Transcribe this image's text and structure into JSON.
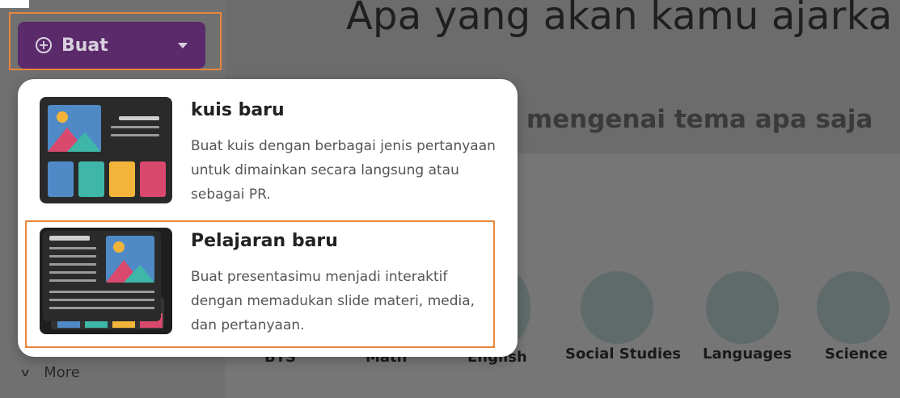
{
  "page": {
    "headline": "Apa yang akan kamu ajarka",
    "subheadline": "z mengenai tema apa saja"
  },
  "create_button": {
    "label": "Buat",
    "plus_icon": "⊕",
    "icon": "plus-circle-icon",
    "caret_icon": "caret-down-icon"
  },
  "create_menu": {
    "items": [
      {
        "title": "kuis baru",
        "description": "Buat kuis dengan berbagai jenis pertanyaan untuk dimainkan secara langsung atau sebagai PR.",
        "icon": "quiz-thumbnail-icon"
      },
      {
        "title": "Pelajaran baru",
        "description": "Buat presentasimu menjadi interaktif dengan memadukan slide materi, media, dan pertanyaan.",
        "icon": "lesson-thumbnail-icon"
      }
    ]
  },
  "categories": [
    {
      "label": "BTS"
    },
    {
      "label": "Math"
    },
    {
      "label": "English"
    },
    {
      "label": "Social Studies"
    },
    {
      "label": "Languages"
    },
    {
      "label": "Science"
    }
  ],
  "sidebar": {
    "more_label": "More",
    "more_icon": "chevron-down-icon"
  },
  "colors": {
    "accent": "#5a2a6a",
    "highlight": "#e9853a",
    "menu_bg": "#ffffff"
  }
}
